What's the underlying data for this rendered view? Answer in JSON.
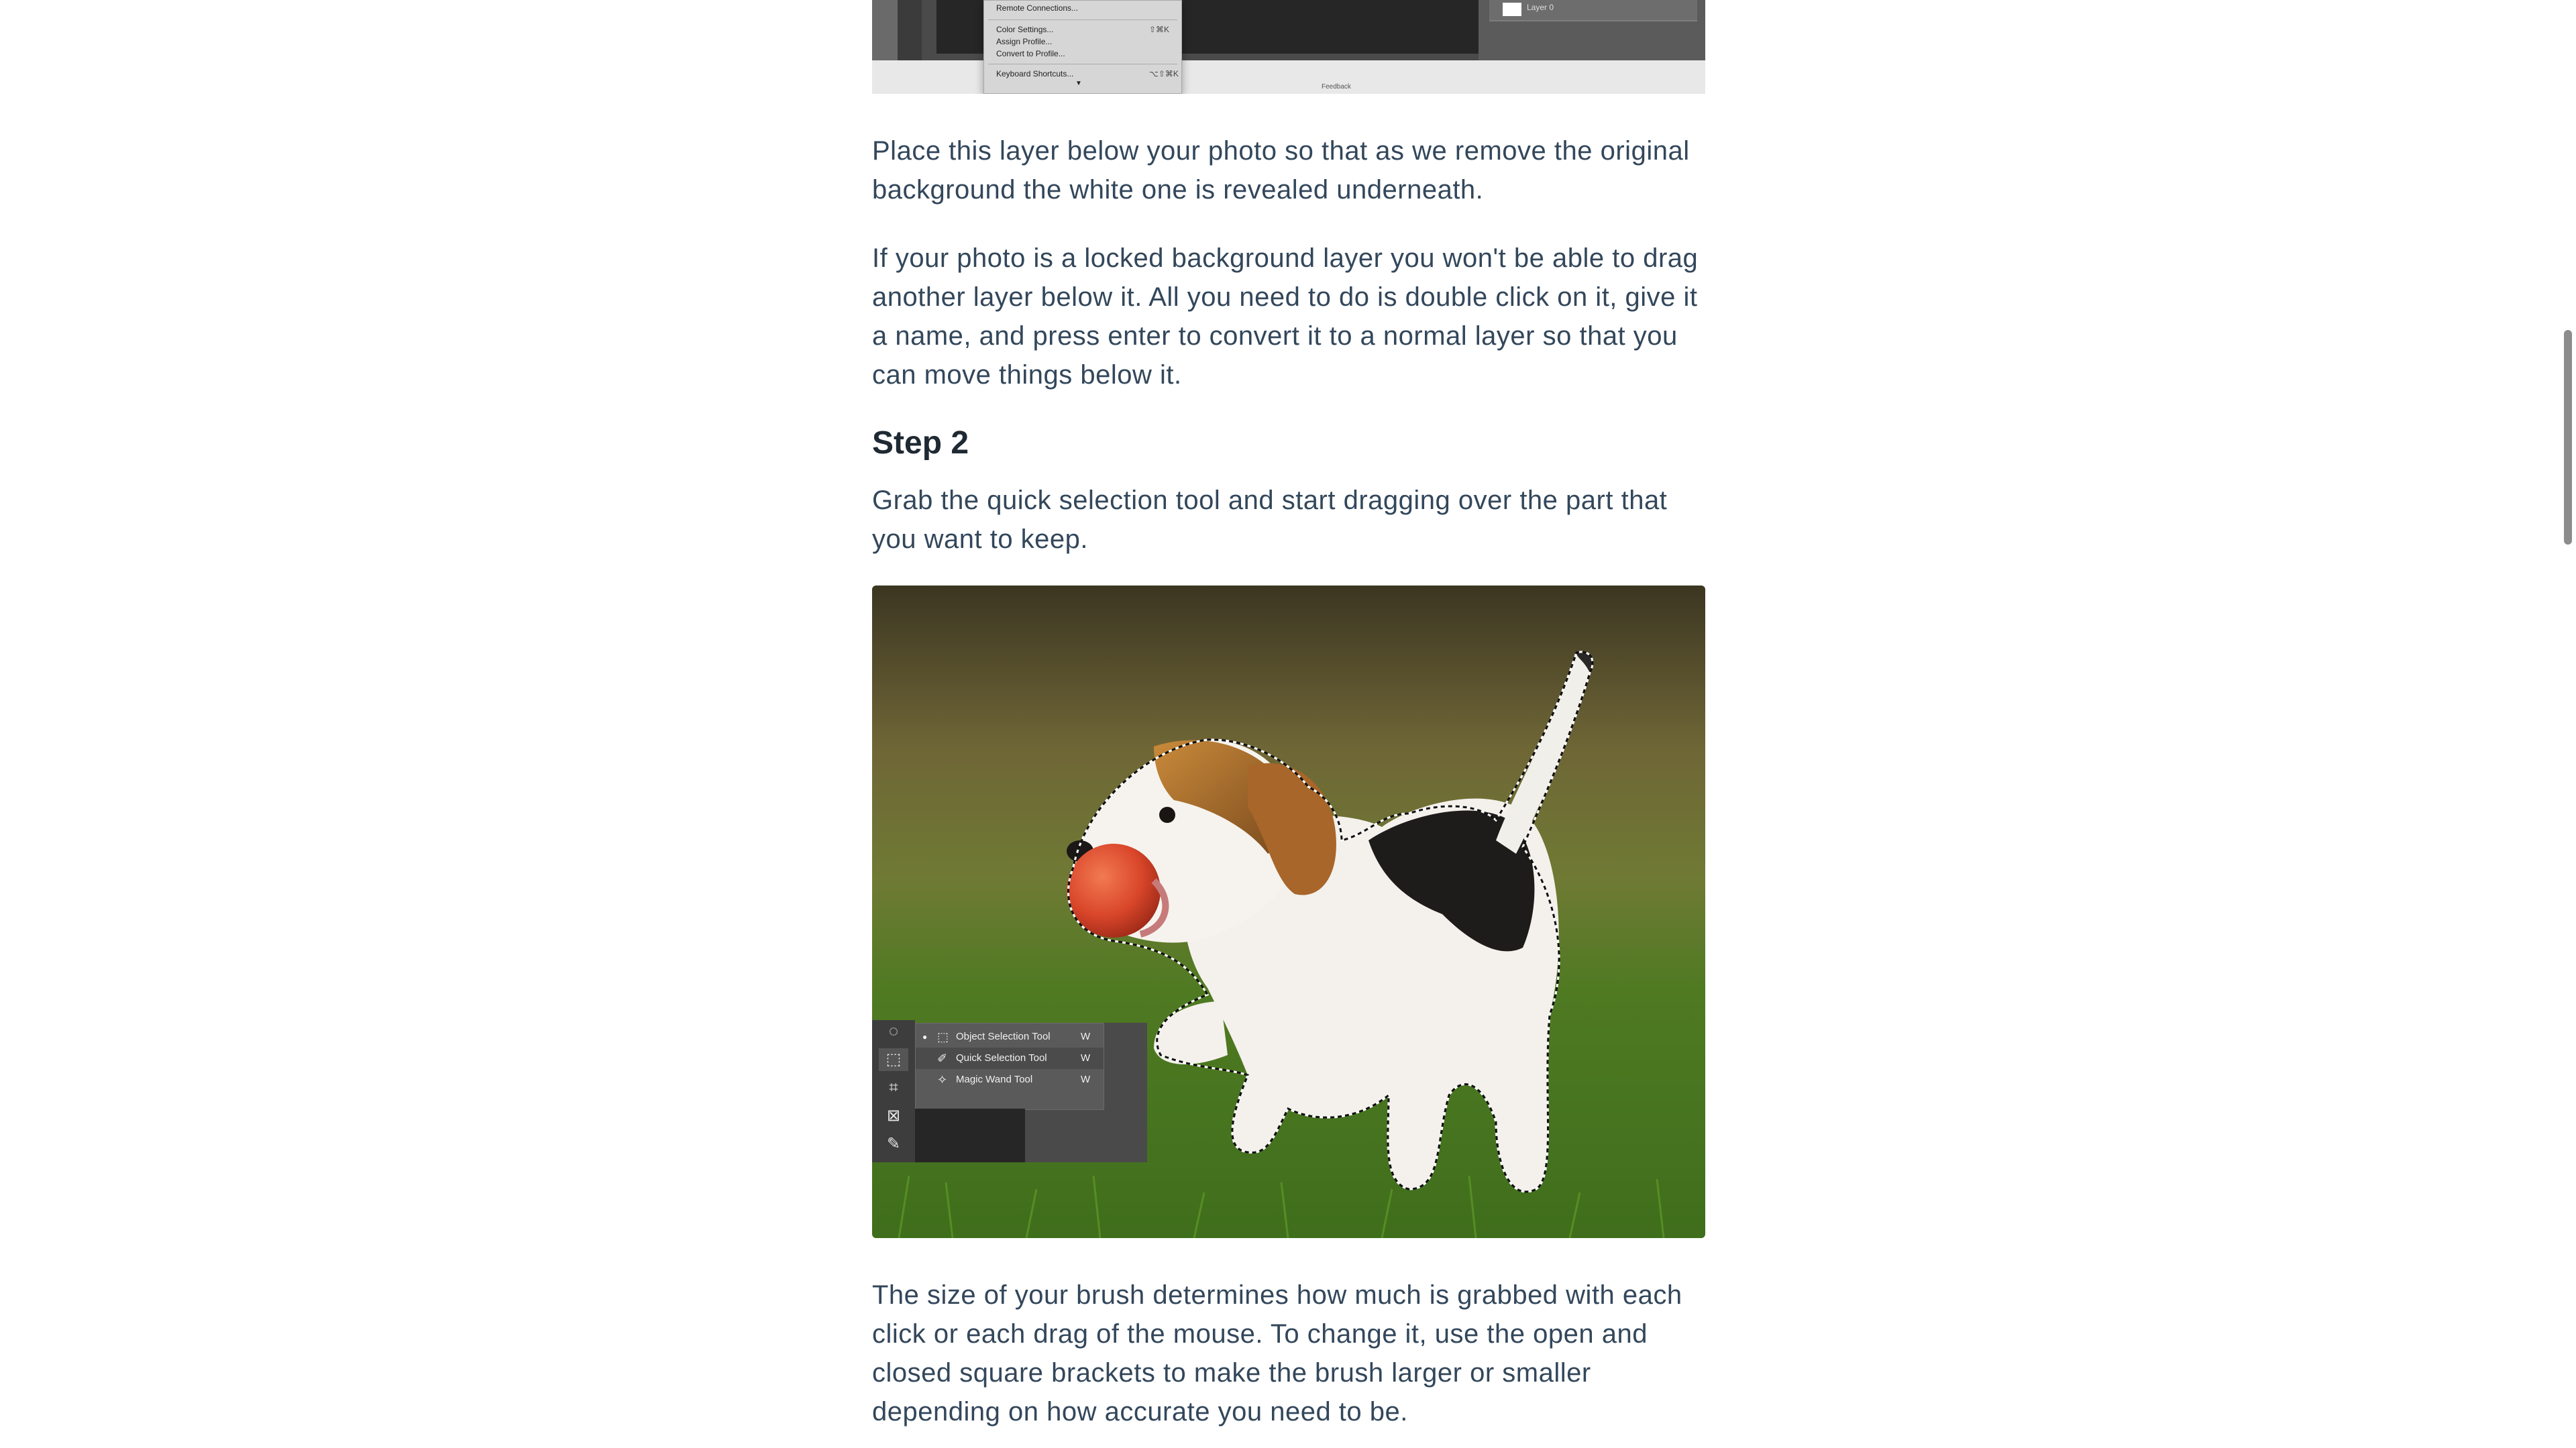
{
  "top_screenshot": {
    "menu_items": [
      {
        "label": "Remote Connections...",
        "shortcut": ""
      },
      {
        "label": "Color Settings...",
        "shortcut": "⇧⌘K"
      },
      {
        "label": "Assign Profile...",
        "shortcut": ""
      },
      {
        "label": "Convert to Profile...",
        "shortcut": ""
      },
      {
        "label": "Keyboard Shortcuts...",
        "shortcut": "⌥⇧⌘K"
      }
    ],
    "layer_name": "Layer 0",
    "feedback_label": "Feedback"
  },
  "article": {
    "paragraph_1": "Place this layer below your photo so that as we remove the original background the white one is revealed underneath.",
    "paragraph_2": "If your photo is a locked background layer you won't be able to drag another layer below it. All you need to do is double click on it, give it a name, and press enter to convert it to a normal layer so that you can move things below it.",
    "step_heading": "Step 2",
    "paragraph_3": "Grab the quick selection tool and start dragging over the part that you want to keep.",
    "paragraph_4": "The size of your brush determines how much is grabbed with each click or each drag of the mouse. To change it, use the open and closed square brackets to make the brush larger or smaller depending on how accurate you need to be."
  },
  "photo_tools": {
    "items": [
      {
        "label": "Object Selection Tool",
        "key": "W",
        "icon": "object-selection-icon",
        "active": false
      },
      {
        "label": "Quick Selection Tool",
        "key": "W",
        "icon": "quick-selection-icon",
        "active": true
      },
      {
        "label": "Magic Wand Tool",
        "key": "W",
        "icon": "magic-wand-icon",
        "active": false
      }
    ]
  },
  "colors": {
    "body_text": "#33475b",
    "heading_text": "#1f2933",
    "scrollbar_thumb": "#8c8c8c"
  }
}
